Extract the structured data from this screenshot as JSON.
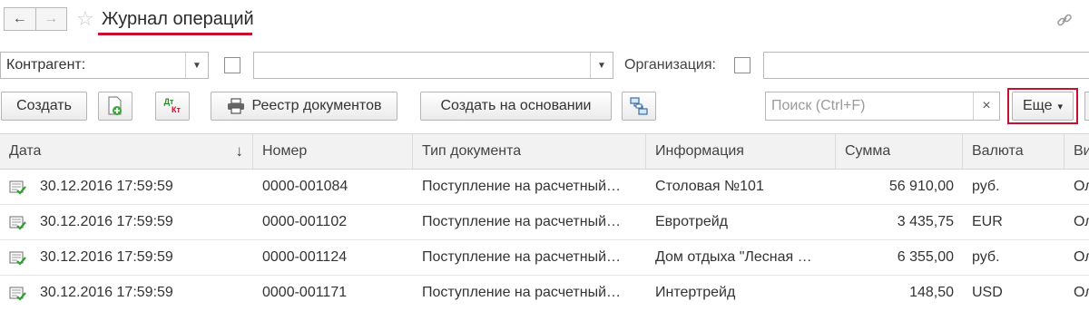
{
  "header": {
    "back_icon": "arrow-left-icon",
    "forward_icon": "arrow-right-icon",
    "favorite_icon": "star-icon",
    "title": "Журнал операций",
    "link_icon": "link-icon",
    "accent_color": "#c8102e"
  },
  "filters": {
    "counterparty_label": "Контрагент:",
    "counterparty_value": "",
    "organization_label": "Организация:",
    "organization_value": ""
  },
  "toolbar": {
    "create_label": "Создать",
    "registry_label": "Реестр документов",
    "create_based_label": "Создать на основании",
    "dtkt_top": "Дт",
    "dtkt_bottom": "Кт",
    "search_placeholder": "Поиск (Ctrl+F)",
    "search_clear": "×",
    "more_label": "Еще",
    "more_arrow": "▾"
  },
  "table": {
    "columns": [
      "Дата",
      "Номер",
      "Тип документа",
      "Информация",
      "Сумма",
      "Валюта",
      "Ви"
    ],
    "sort_indicator": "↓",
    "rows": [
      {
        "date": "30.12.2016 17:59:59",
        "number": "0000-001084",
        "doc_type": "Поступление на расчетный…",
        "info": "Столовая №101",
        "sum": "56 910,00",
        "currency": "руб.",
        "extra": "Ол"
      },
      {
        "date": "30.12.2016 17:59:59",
        "number": "0000-001102",
        "doc_type": "Поступление на расчетный…",
        "info": "Евротрейд",
        "sum": "3 435,75",
        "currency": "EUR",
        "extra": "Ол"
      },
      {
        "date": "30.12.2016 17:59:59",
        "number": "0000-001124",
        "doc_type": "Поступление на расчетный…",
        "info": "Дом отдыха \"Лесная …",
        "sum": "6 355,00",
        "currency": "руб.",
        "extra": "Ол"
      },
      {
        "date": "30.12.2016 17:59:59",
        "number": "0000-001171",
        "doc_type": "Поступление на расчетный…",
        "info": "Интертрейд",
        "sum": "148,50",
        "currency": "USD",
        "extra": "Ол"
      }
    ]
  }
}
